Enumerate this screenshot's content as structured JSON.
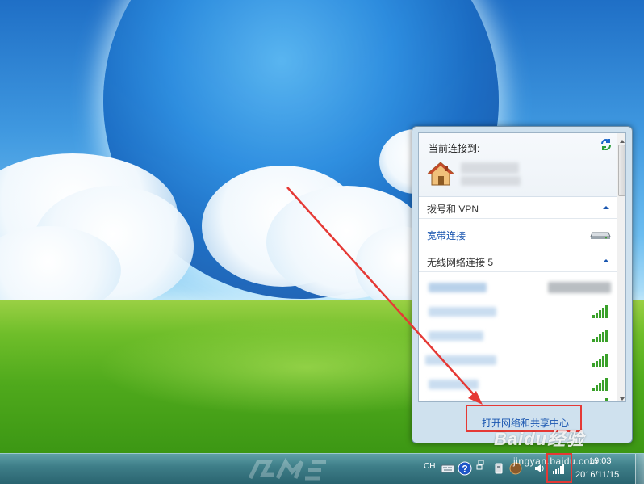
{
  "flyout": {
    "current_connection_label": "当前连接到:",
    "section_dialup_title": "拨号和 VPN",
    "broadband_link": "宽带连接",
    "section_wireless_title": "无线网络连接 5",
    "footer_link": "打开网络和共享中心",
    "wireless_network_count": 6
  },
  "taskbar": {
    "language_indicator": "CH",
    "clock_time": "19:03",
    "clock_date": "2016/11/15"
  },
  "watermark": {
    "text": "Baidu经验",
    "url": "jingyan.baidu.com"
  },
  "colors": {
    "link_blue": "#1a56b0",
    "annotation_red": "#e53935",
    "signal_green": "#3aa12a"
  },
  "icons": {
    "refresh": "refresh-icon",
    "house": "house-icon",
    "modem": "modem-icon",
    "signal": "wifi-signal-icon",
    "help": "help-icon"
  }
}
